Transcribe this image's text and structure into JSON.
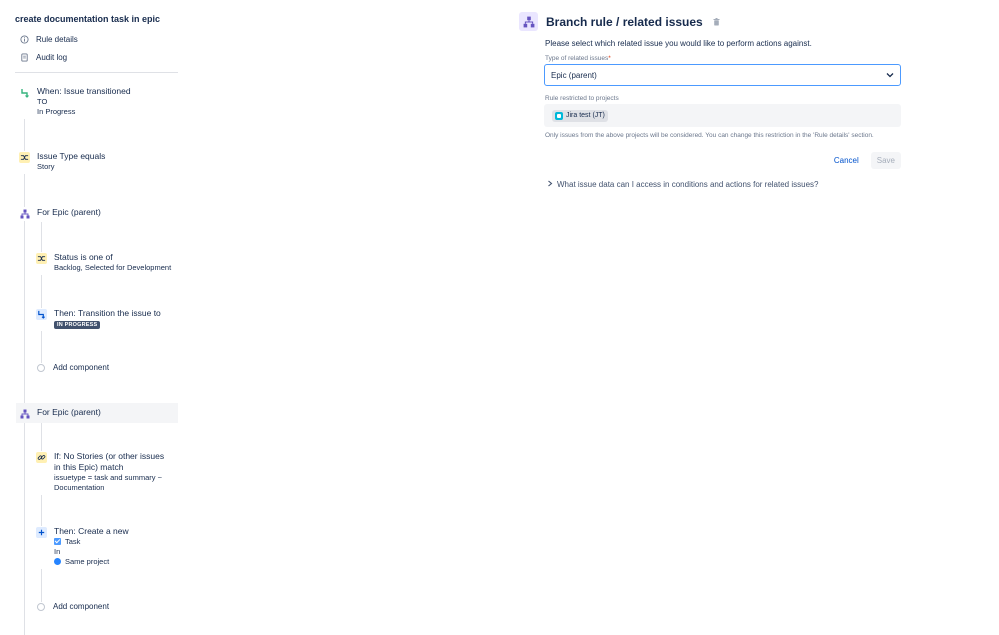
{
  "rule": {
    "title": "create documentation task in epic",
    "nav": [
      {
        "label": "Rule details",
        "icon": "info-icon"
      },
      {
        "label": "Audit log",
        "icon": "document-icon"
      }
    ]
  },
  "components": {
    "trigger": {
      "title": "When: Issue transitioned",
      "line1": "TO",
      "line2": "In Progress"
    },
    "condition_issue_type": {
      "title": "Issue Type equals",
      "sub": "Story"
    },
    "branch1": {
      "title": "For Epic (parent)"
    },
    "condition_status": {
      "title": "Status is one of",
      "sub": "Backlog, Selected for Development"
    },
    "action_transition": {
      "title": "Then: Transition the issue to",
      "lozenge": "IN PROGRESS"
    },
    "add1": {
      "label": "Add component"
    },
    "branch2": {
      "title": "For Epic (parent)"
    },
    "if_condition": {
      "title_line1": "If: No Stories (or other issues",
      "title_line2": "in this Epic) match",
      "sub_line1": "issuetype = task and summary ~",
      "sub_line2": "Documentation"
    },
    "action_create": {
      "title": "Then: Create a new",
      "issue_type": "Task",
      "in_label": "In",
      "project": "Same project"
    },
    "add2": {
      "label": "Add component"
    }
  },
  "editor": {
    "title": "Branch rule / related issues",
    "description": "Please select which related issue you would like to perform actions against.",
    "type_label": "Type of related issues",
    "required_mark": "*",
    "type_value": "Epic (parent)",
    "projects_label": "Rule restricted to projects",
    "project_chip": "Jira test (JT)",
    "note": "Only issues from the above projects will be considered. You can change this restriction in the 'Rule details' section.",
    "cancel_label": "Cancel",
    "save_label": "Save",
    "expander_label": "What issue data can I access in conditions and actions for related issues?"
  },
  "colors": {
    "trigger": "#36b37e",
    "condition": "#fff0b3",
    "branch": "#6554c0",
    "action": "#deebff",
    "link": "#0052cc",
    "lozenge": "#42526e"
  }
}
